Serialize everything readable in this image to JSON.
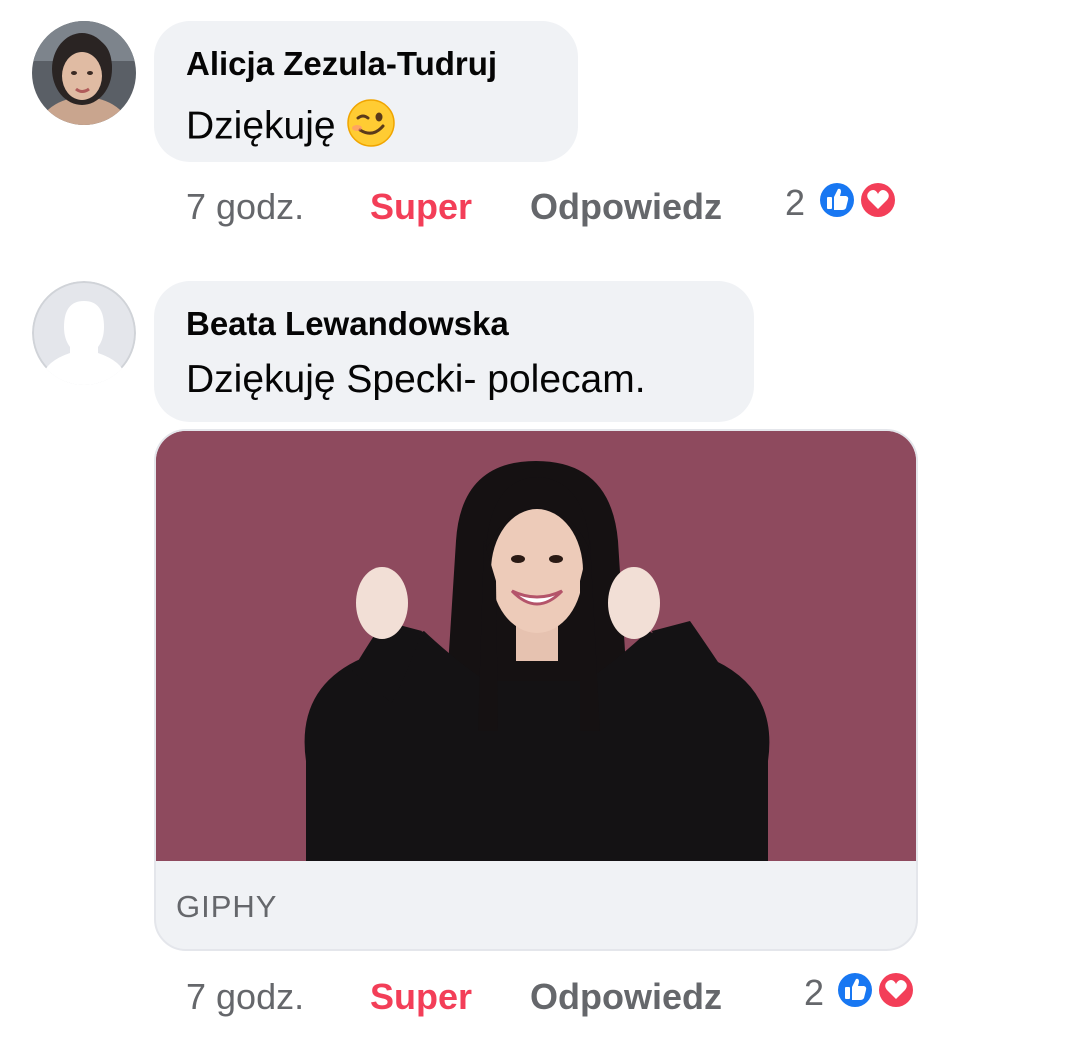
{
  "comments": [
    {
      "author": "Alicja Zezula-Tudruj",
      "text": "Dziękuję",
      "emoji": "winking-face",
      "time": "7 godz.",
      "reaction_label": "Super",
      "reply_label": "Odpowiedz",
      "reaction_count": "2",
      "reaction_icons": [
        "like-icon",
        "love-icon"
      ]
    },
    {
      "author": "Beata Lewandowska",
      "text": "Dziękuję Specki- polecam.",
      "gif_source": "GIPHY",
      "time": "7 godz.",
      "reaction_label": "Super",
      "reply_label": "Odpowiedz",
      "reaction_count": "2",
      "reaction_icons": [
        "like-icon",
        "love-icon"
      ]
    }
  ],
  "colors": {
    "bubble": "#f0f2f5",
    "super": "#f33e58",
    "like": "#1877f2",
    "love": "#f33e58",
    "gif_background": "#8e4a5e"
  }
}
